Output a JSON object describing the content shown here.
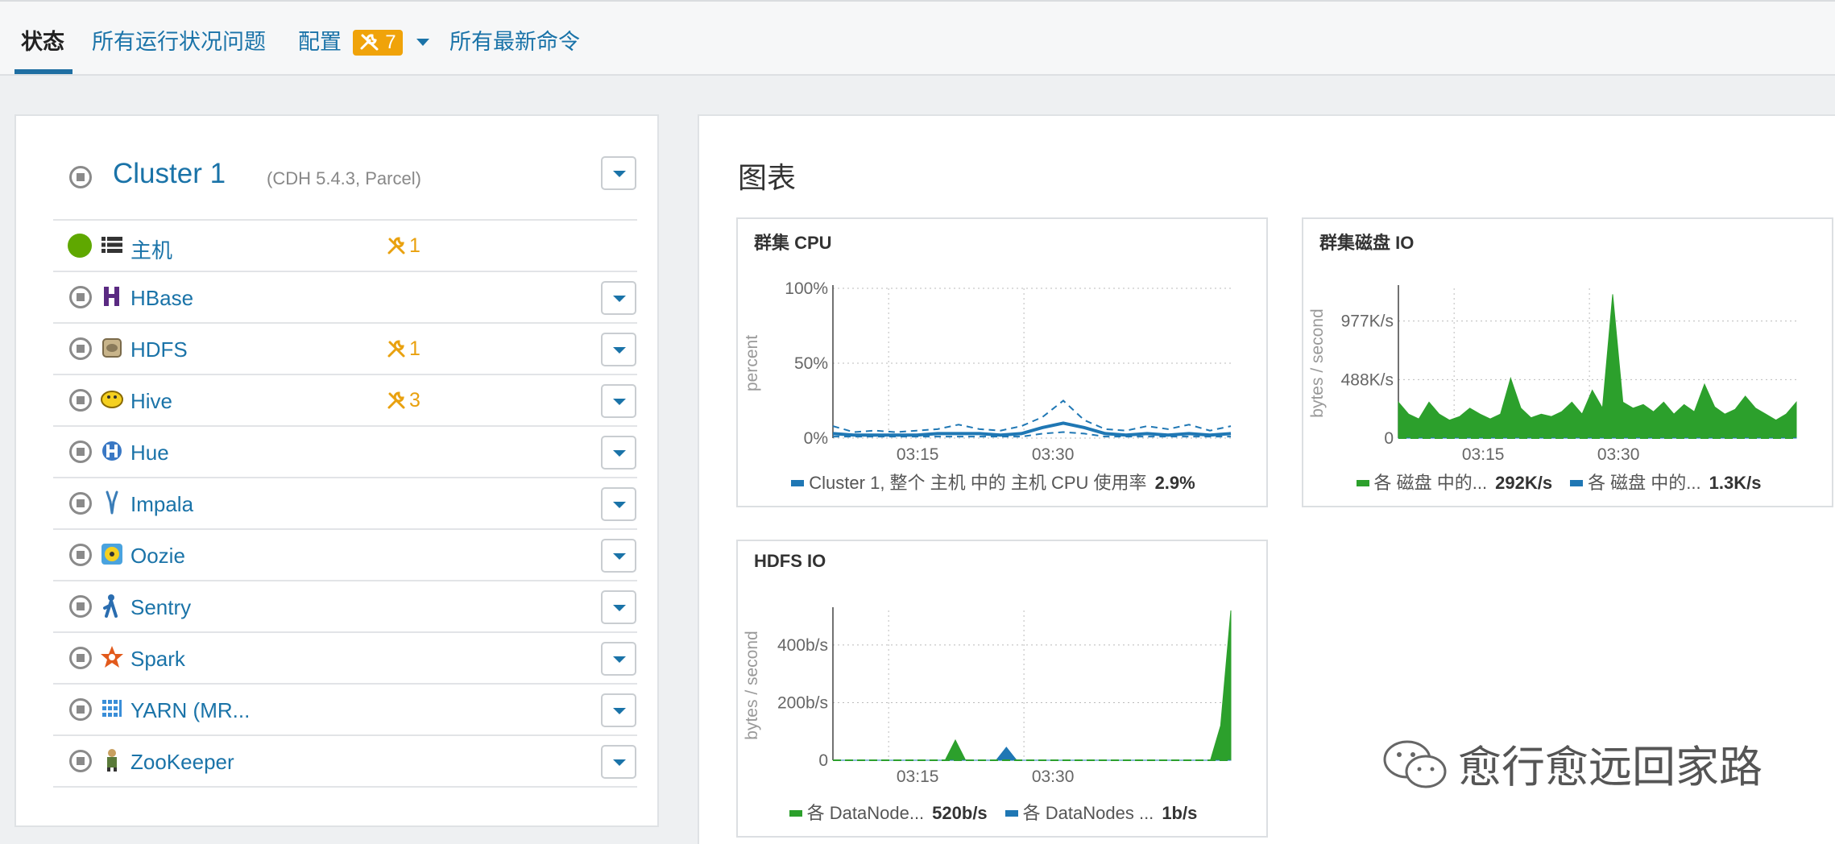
{
  "nav": {
    "tabs": [
      {
        "label": "状态",
        "active": true
      },
      {
        "label": "所有运行状况问题"
      },
      {
        "label": "配置"
      },
      {
        "label": "所有最新命令"
      }
    ],
    "config_badge": "7"
  },
  "cluster": {
    "name": "Cluster 1",
    "subtitle": "(CDH 5.4.3, Parcel)"
  },
  "services": [
    {
      "name": "主机",
      "icon": "hosts-list-icon",
      "status": "good",
      "warnings": "1",
      "has_dropdown": false
    },
    {
      "name": "HBase",
      "icon": "hbase-icon",
      "status": "stopped",
      "warnings": "",
      "has_dropdown": true
    },
    {
      "name": "HDFS",
      "icon": "hdfs-icon",
      "status": "stopped",
      "warnings": "1",
      "has_dropdown": true
    },
    {
      "name": "Hive",
      "icon": "hive-icon",
      "status": "stopped",
      "warnings": "3",
      "has_dropdown": true
    },
    {
      "name": "Hue",
      "icon": "hue-icon",
      "status": "stopped",
      "warnings": "",
      "has_dropdown": true
    },
    {
      "name": "Impala",
      "icon": "impala-icon",
      "status": "stopped",
      "warnings": "",
      "has_dropdown": true
    },
    {
      "name": "Oozie",
      "icon": "oozie-icon",
      "status": "stopped",
      "warnings": "",
      "has_dropdown": true
    },
    {
      "name": "Sentry",
      "icon": "sentry-icon",
      "status": "stopped",
      "warnings": "",
      "has_dropdown": true
    },
    {
      "name": "Spark",
      "icon": "spark-icon",
      "status": "stopped",
      "warnings": "",
      "has_dropdown": true
    },
    {
      "name": "YARN (MR...",
      "icon": "yarn-icon",
      "status": "stopped",
      "warnings": "",
      "has_dropdown": true
    },
    {
      "name": "ZooKeeper",
      "icon": "zookeeper-icon",
      "status": "stopped",
      "warnings": "",
      "has_dropdown": true
    }
  ],
  "charts_section": {
    "title": "图表"
  },
  "colors": {
    "link": "#1a73a8",
    "warning": "#f0a30a",
    "good": "#5fa800",
    "series_green": "#2ca02c",
    "series_blue": "#1f77b4"
  },
  "chart_data": [
    {
      "type": "line",
      "title": "群集 CPU",
      "ylabel": "percent",
      "ylim": [
        0,
        100
      ],
      "yticks": [
        "100%",
        "50%",
        "0%"
      ],
      "xticks": [
        "03:15",
        "03:30"
      ],
      "x": [
        0,
        1,
        2,
        3,
        4,
        5,
        6,
        7,
        8,
        9,
        10,
        11,
        12,
        13,
        14,
        15,
        16,
        17,
        18,
        19
      ],
      "series": [
        {
          "name": "Cluster 1, 整个 主机 中的 主机 CPU 使用率",
          "values": [
            3,
            2,
            2,
            2,
            2,
            3,
            3,
            3,
            2,
            3,
            7,
            10,
            7,
            3,
            2,
            3,
            2,
            3,
            2,
            3
          ],
          "summary": "2.9%"
        }
      ],
      "max_values": [
        8,
        4,
        5,
        4,
        5,
        6,
        9,
        6,
        5,
        8,
        14,
        25,
        12,
        6,
        5,
        8,
        6,
        9,
        5,
        8
      ],
      "min_values": [
        1,
        1,
        1,
        1,
        1,
        1,
        1,
        1,
        1,
        1,
        3,
        4,
        3,
        1,
        1,
        1,
        1,
        1,
        1,
        1
      ]
    },
    {
      "type": "area",
      "title": "群集磁盘 IO",
      "ylabel": "bytes / second",
      "yticks": [
        "977K/s",
        "488K/s",
        "0"
      ],
      "ylim": [
        0,
        1250
      ],
      "xticks": [
        "03:15",
        "03:30"
      ],
      "x": [
        0,
        1,
        2,
        3,
        4,
        5,
        6,
        7,
        8,
        9,
        10,
        11,
        12,
        13,
        14,
        15,
        16,
        17,
        18,
        19,
        20,
        21,
        22,
        23,
        24,
        25,
        26,
        27,
        28,
        29,
        30,
        31,
        32,
        33,
        34,
        35,
        36,
        37,
        38,
        39
      ],
      "series": [
        {
          "name": "各 磁盘 中的...",
          "values": [
            300,
            200,
            160,
            300,
            200,
            150,
            180,
            250,
            200,
            160,
            200,
            500,
            250,
            170,
            200,
            180,
            220,
            300,
            200,
            400,
            250,
            1200,
            300,
            250,
            280,
            220,
            300,
            200,
            280,
            220,
            450,
            260,
            200,
            240,
            350,
            250,
            200,
            150,
            200,
            300
          ],
          "summary": "292K/s"
        },
        {
          "name": "各 磁盘 中的...",
          "values": [
            2,
            1,
            1,
            1,
            2,
            1,
            1,
            1,
            1,
            2,
            1,
            1,
            1,
            1,
            2,
            1,
            1,
            1,
            1,
            2,
            1,
            1,
            1,
            1,
            2,
            1,
            1,
            1,
            1,
            2,
            1,
            1,
            1,
            1,
            2,
            1,
            1,
            1,
            1,
            2
          ],
          "summary": "1.3K/s"
        }
      ]
    },
    {
      "type": "area",
      "title": "HDFS IO",
      "ylabel": "bytes / second",
      "yticks": [
        "400b/s",
        "200b/s",
        "0"
      ],
      "ylim": [
        0,
        520
      ],
      "xticks": [
        "03:15",
        "03:30"
      ],
      "x": [
        0,
        1,
        2,
        3,
        4,
        5,
        6,
        7,
        8,
        9,
        10,
        11,
        12,
        13,
        14,
        15,
        16,
        17,
        18,
        19,
        20,
        21,
        22,
        23,
        24,
        25,
        26,
        27,
        28,
        29,
        30,
        31,
        32,
        33,
        34,
        35,
        36,
        37,
        38,
        39
      ],
      "series": [
        {
          "name": "各 DataNode...",
          "values": [
            0,
            0,
            0,
            0,
            0,
            0,
            0,
            0,
            0,
            0,
            0,
            0,
            70,
            0,
            0,
            0,
            0,
            40,
            0,
            0,
            0,
            0,
            0,
            0,
            0,
            0,
            0,
            0,
            0,
            0,
            0,
            0,
            0,
            0,
            0,
            0,
            0,
            0,
            120,
            520
          ],
          "summary": "520b/s"
        },
        {
          "name": "各 DataNodes ...",
          "values": [
            0,
            0,
            0,
            0,
            0,
            0,
            0,
            0,
            0,
            0,
            0,
            0,
            0,
            0,
            0,
            0,
            0,
            45,
            0,
            0,
            0,
            0,
            0,
            0,
            0,
            0,
            0,
            0,
            0,
            0,
            0,
            0,
            0,
            0,
            0,
            0,
            0,
            0,
            0,
            0
          ],
          "summary": "1b/s"
        }
      ]
    }
  ],
  "watermark": {
    "text": "愈行愈远回家路"
  }
}
